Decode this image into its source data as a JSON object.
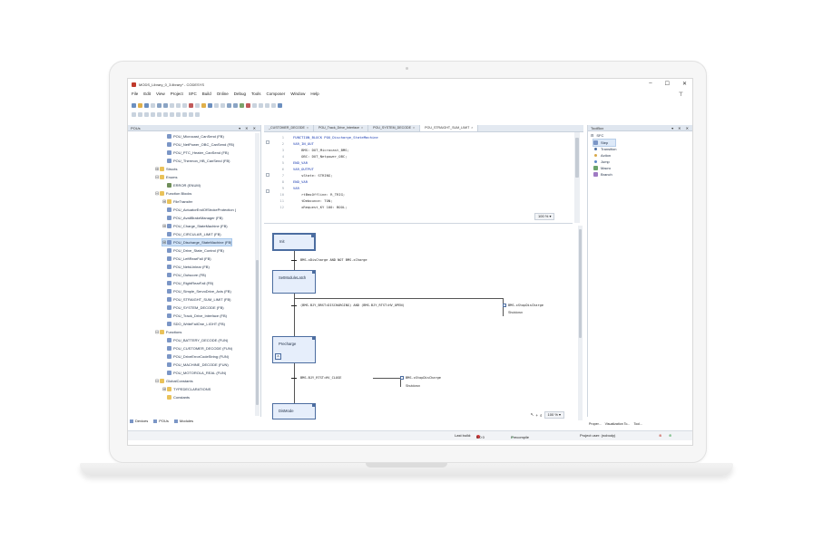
{
  "window": {
    "title": "MODS_Library_0_3.library* - CODESYS",
    "controls": [
      "–",
      "☐",
      "✕"
    ],
    "pin": "⊤"
  },
  "menu": [
    "File",
    "Edit",
    "View",
    "Project",
    "SFC",
    "Build",
    "Online",
    "Debug",
    "Tools",
    "Composer",
    "Window",
    "Help"
  ],
  "pous_panel": {
    "title": "POUs",
    "controls": "▾ ✕ ✕",
    "tree": [
      {
        "label": "POU_Microcast_CanSend (FB)",
        "type": "pou",
        "indent": 1
      },
      {
        "label": "POU_NetPower_OBC_CanSend (FB)",
        "type": "pou",
        "indent": 1
      },
      {
        "label": "POU_PTC_Heater_CanSend (FB)",
        "type": "pou",
        "indent": 1
      },
      {
        "label": "POU_Thermon_HB_CanSend (FB)",
        "type": "pou",
        "indent": 1
      },
      {
        "label": "Structs",
        "type": "folder",
        "indent": 0,
        "exp": "⊞"
      },
      {
        "label": "Enums",
        "type": "folder",
        "indent": 0,
        "exp": "⊟"
      },
      {
        "label": "ERROR (ENUM)",
        "type": "enum",
        "indent": 1
      },
      {
        "label": "Function Blocks",
        "type": "folder",
        "indent": 0,
        "exp": "⊟"
      },
      {
        "label": "FileTransfer",
        "type": "folder",
        "indent": 1,
        "exp": "⊞"
      },
      {
        "label": "POU_ActuatorEndOfStrokeProtection (",
        "type": "pou",
        "indent": 1
      },
      {
        "label": "POU_AvailBrakeManager (FB)",
        "type": "pou",
        "indent": 1
      },
      {
        "label": "POU_Charge_StateMachine (FB)",
        "type": "pou",
        "indent": 1,
        "exp": "⊞"
      },
      {
        "label": "POU_CIRCULAR_LIMIT (FB)",
        "type": "pou",
        "indent": 1
      },
      {
        "label": "POU_Discharge_StateMachine (FB)",
        "type": "pou",
        "indent": 1,
        "exp": "⊞",
        "selected": true
      },
      {
        "label": "POU_Drive_State_Control (FB)",
        "type": "pou",
        "indent": 1
      },
      {
        "label": "POU_LeftRearFall (FB)",
        "type": "pou",
        "indent": 1
      },
      {
        "label": "POU_NetsUnlear (FB)",
        "type": "pou",
        "indent": 1
      },
      {
        "label": "POU_Outscore (FB)",
        "type": "pou",
        "indent": 1
      },
      {
        "label": "POU_RightRearFall (FB)",
        "type": "pou",
        "indent": 1
      },
      {
        "label": "POU_Simple_ServoDrive_Axis (FB)",
        "type": "pou",
        "indent": 1
      },
      {
        "label": "POU_STRAIGHT_SUM_LIMIT (FB)",
        "type": "pou",
        "indent": 1
      },
      {
        "label": "POU_SYSTEM_DECODE (FB)",
        "type": "pou",
        "indent": 1
      },
      {
        "label": "POU_Track_Drive_Interface (FB)",
        "type": "pou",
        "indent": 1
      },
      {
        "label": "SDO_WriteFailOne_LIGHT (FB)",
        "type": "pou",
        "indent": 1
      },
      {
        "label": "Functions",
        "type": "folder",
        "indent": 0,
        "exp": "⊟"
      },
      {
        "label": "POU_BATTERY_DECODE (FUN)",
        "type": "pou",
        "indent": 1
      },
      {
        "label": "POU_CUSTOMER_DECODE (FUN)",
        "type": "pou",
        "indent": 1
      },
      {
        "label": "POU_DriveErrorCodeString (FUN)",
        "type": "pou",
        "indent": 1
      },
      {
        "label": "POU_MACHINE_DECODE (FUN)",
        "type": "pou",
        "indent": 1
      },
      {
        "label": "POU_MOTOROLA_REAL (FUN)",
        "type": "pou",
        "indent": 1
      },
      {
        "label": "GlobalConstants",
        "type": "folder",
        "indent": 0,
        "exp": "⊟"
      },
      {
        "label": "TYPEDECLARATIONS",
        "type": "folder",
        "indent": 1,
        "exp": "⊞"
      },
      {
        "label": "Constants",
        "type": "folder",
        "indent": 1
      }
    ],
    "bottom_tabs": [
      "Devices",
      "POUs",
      "Modules"
    ]
  },
  "editor": {
    "tabs": [
      "_CUSTOMER_DECODE",
      "POU_Track_Drive_Interface",
      "POU_SYSTEM_DECODE",
      "POU_STRAIGHT_SUM_LIMIT"
    ],
    "code": [
      {
        "n": "1",
        "t": "FUNCTION_BLOCK POU_Discharge_StateMachine",
        "k": true
      },
      {
        "n": "2",
        "t": "VAR_IN_OUT",
        "k": true
      },
      {
        "n": "3",
        "t": "    BMS: DUT_Microcast_BMS;",
        "k": false
      },
      {
        "n": "4",
        "t": "    OBC: DUT_Netpower_OBC;",
        "k": false
      },
      {
        "n": "5",
        "t": "END_VAR",
        "k": true
      },
      {
        "n": "6",
        "t": "VAR_OUTPUT",
        "k": true
      },
      {
        "n": "7",
        "t": "    sState: STRING;",
        "k": false
      },
      {
        "n": "8",
        "t": "END_VAR",
        "k": true
      },
      {
        "n": "9",
        "t": "VAR",
        "k": true
      },
      {
        "n": "10",
        "t": "    rtBmsOffline: R_TRIG;",
        "k": false
      },
      {
        "n": "11",
        "t": "    tDebounce: TON;",
        "k": false
      },
      {
        "n": "12",
        "t": "    xRequest_KY 100: BOOL;",
        "k": false
      }
    ],
    "code_zoom": "100 %",
    "sfc_zoom": "100 %",
    "steps": [
      "Init",
      "SetModuleLatch",
      "Precharge",
      "DisMode"
    ],
    "transitions": [
      "BMS.xDisCharge AND NOT BMS.xCharge",
      "(BMS.BJY_BRST=DISCHARGING) AND (BMS.BJY_RTST=HV_OPEN)",
      "BMS.BJY_RTST=HV_CLOSE"
    ],
    "actions": [
      {
        "name": "BMS.xStopDisCharge",
        "sub": "Shutdown"
      },
      {
        "name": "BMS.xStopDisCharge",
        "sub": "Shutdown"
      }
    ]
  },
  "toolbox": {
    "title": "ToolBox",
    "section": "SFC",
    "items": [
      "Step",
      "Transition",
      "Action",
      "Jump",
      "Macro",
      "Branch"
    ],
    "bottom_tabs": [
      "Proper...",
      "Visualization To...",
      "Tool..."
    ]
  },
  "status": {
    "last_build": "Last build:",
    "counts": "0  0  0",
    "precompile": "Precompile",
    "project_user": "Project user: (nobody)"
  }
}
